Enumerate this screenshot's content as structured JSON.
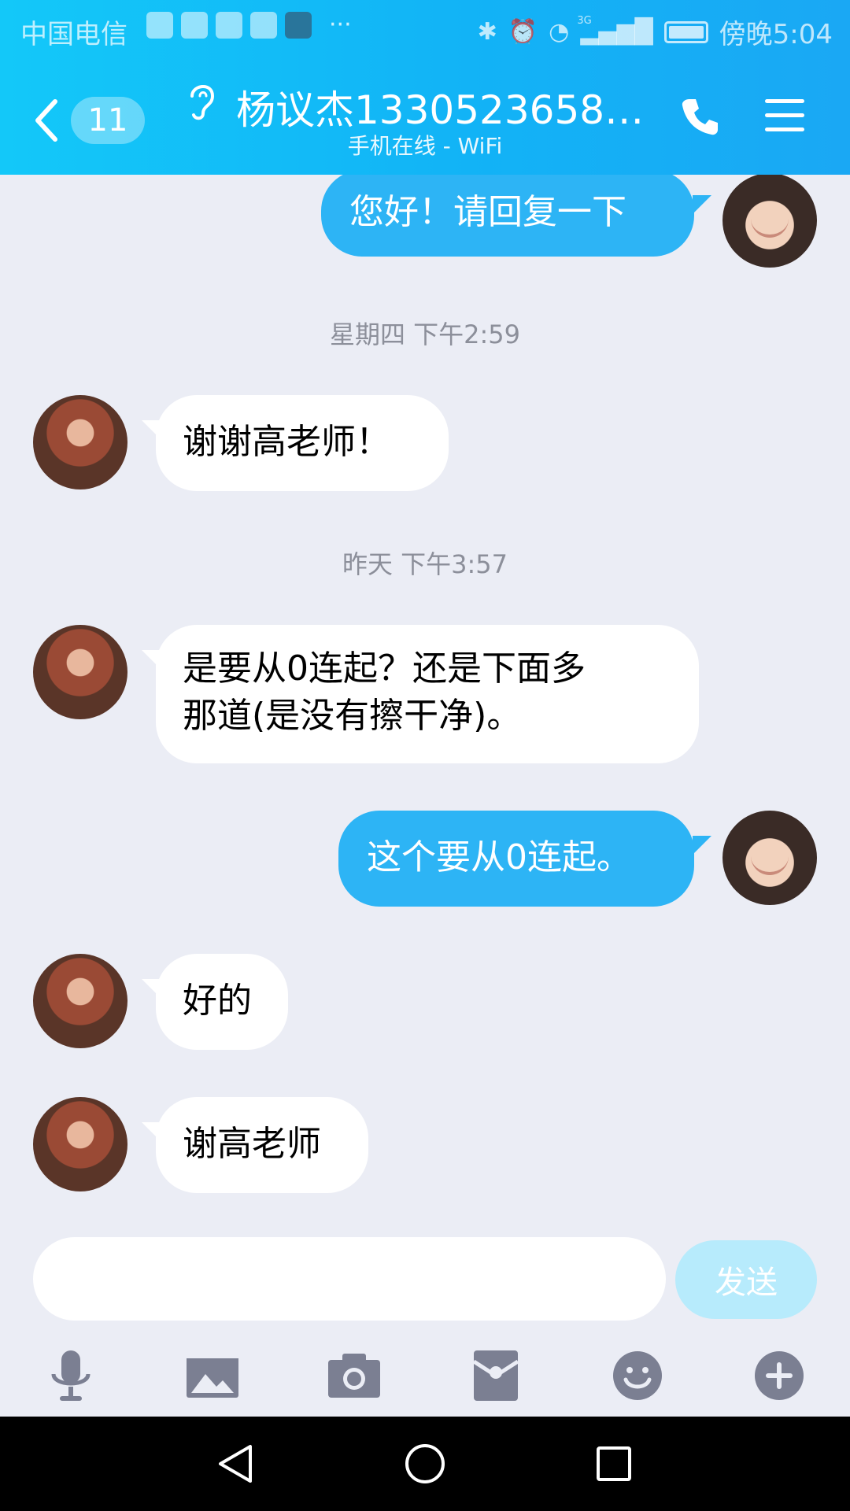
{
  "status_bar": {
    "carrier": "中国电信",
    "time": "傍晚5:04",
    "network_badge": "3G",
    "more": "···"
  },
  "header": {
    "unread_count": "11",
    "contact_name": "杨议杰13305236582...",
    "contact_status": "手机在线 - WiFi"
  },
  "messages": [
    {
      "side": "out",
      "text": "您好！请回复一下"
    },
    {
      "type": "time",
      "text": "星期四 下午2:59"
    },
    {
      "side": "in",
      "text": "谢谢高老师！"
    },
    {
      "type": "time",
      "text": "昨天 下午3:57"
    },
    {
      "side": "in",
      "lines": [
        "是要从0连起？还是下面多",
        "那道(是没有擦干净)。"
      ]
    },
    {
      "side": "out",
      "text": "这个要从0连起。"
    },
    {
      "side": "in",
      "text": "好的"
    },
    {
      "side": "in",
      "text": "谢高老师"
    }
  ],
  "composer": {
    "input_value": "",
    "send_label": "发送"
  },
  "toolbar_icons": [
    "microphone-icon",
    "image-icon",
    "camera-icon",
    "red-packet-icon",
    "emoji-icon",
    "plus-icon"
  ],
  "colors": {
    "header": "#12b3f6",
    "outgoing_bubble": "#2db4f5",
    "incoming_bubble": "#ffffff",
    "chat_bg": "#ebedf5",
    "send_button": "#b7ebfc",
    "toolbar_icon": "#7b7f92"
  }
}
